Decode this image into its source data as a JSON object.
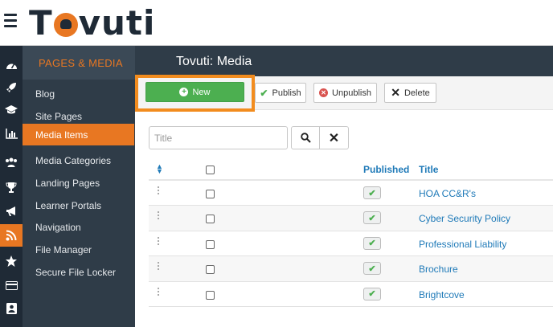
{
  "header": {
    "logo_text_left": "T",
    "logo_text_right": "vuti"
  },
  "sidebar": {
    "section_title": "PAGES & MEDIA",
    "items": [
      {
        "label": "Blog",
        "active": false
      },
      {
        "label": "Site Pages",
        "active": false
      },
      {
        "label": "Media Items",
        "active": true
      },
      {
        "label": "Media Categories",
        "active": false
      },
      {
        "label": "Landing Pages",
        "active": false
      },
      {
        "label": "Learner Portals",
        "active": false
      },
      {
        "label": "Navigation",
        "active": false
      },
      {
        "label": "File Manager",
        "active": false
      },
      {
        "label": "Secure File Locker",
        "active": false
      }
    ]
  },
  "icon_rail": [
    "dashboard-icon",
    "rocket-icon",
    "graduation-cap-icon",
    "bar-chart-icon",
    "users-icon",
    "trophy-icon",
    "megaphone-icon",
    "feed-icon",
    "star-icon",
    "credit-card-icon",
    "id-card-icon"
  ],
  "main": {
    "title": "Tovuti: Media"
  },
  "toolbar": {
    "new_label": "New",
    "publish_label": "Publish",
    "unpublish_label": "Unpublish",
    "delete_label": "Delete"
  },
  "search": {
    "placeholder": "Title",
    "value": ""
  },
  "table": {
    "headers": {
      "published": "Published",
      "title": "Title"
    },
    "rows": [
      {
        "title": "HOA CC&R's",
        "published": true
      },
      {
        "title": "Cyber Security Policy",
        "published": true
      },
      {
        "title": "Professional Liability",
        "published": true
      },
      {
        "title": "Brochure",
        "published": true
      },
      {
        "title": "Brightcove",
        "published": true
      }
    ]
  },
  "colors": {
    "accent": "#e87722",
    "nav_dark": "#2f3c48",
    "link": "#1f7ab8",
    "success": "#4caf50",
    "danger": "#d9534f"
  }
}
